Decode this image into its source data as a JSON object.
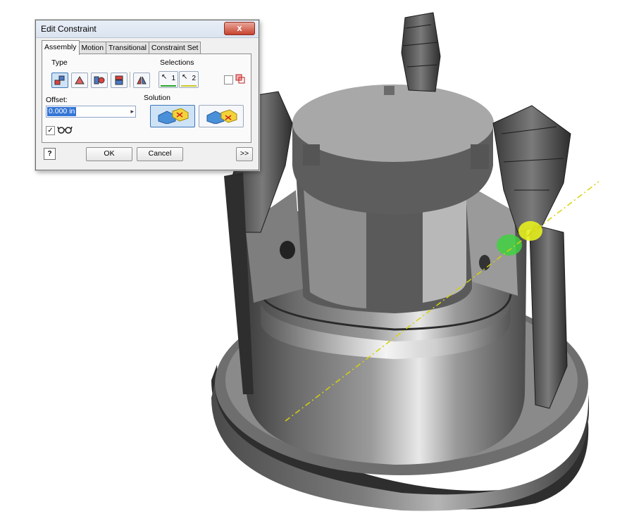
{
  "dialog": {
    "title": "Edit Constraint",
    "close_label": "x",
    "tabs": [
      "Assembly",
      "Motion",
      "Transitional",
      "Constraint Set"
    ],
    "type_label": "Type",
    "selections_label": "Selections",
    "selection_1": "1",
    "selection_2": "2",
    "offset_label": "Offset:",
    "offset_value": "0.000 in",
    "solution_label": "Solution",
    "ok_label": "OK",
    "cancel_label": "Cancel",
    "more_label": ">>",
    "help_label": "?",
    "show_preview_checked": true,
    "predict_offset_checked": false
  },
  "icons": {
    "close": "close-icon",
    "mate": "mate-icon",
    "angle": "angle-icon",
    "tangent": "tangent-icon",
    "insert": "insert-icon",
    "symmetry": "symmetry-icon",
    "select_first": "cursor-1-icon",
    "select_second": "cursor-2-icon",
    "pick_part_first": "pick-part-first-icon",
    "preview": "glasses-icon",
    "help": "help-icon",
    "solution_mate": "solution-mate-icon",
    "solution_flush": "solution-flush-icon"
  },
  "colors": {
    "selection_1_underline": "#2aa52a",
    "selection_2_underline": "#c9c92a",
    "highlight_green": "#3fd13f",
    "highlight_yellow": "#e7ef1f",
    "axis_line": "#d6d20a",
    "model_gray": "#808080"
  }
}
